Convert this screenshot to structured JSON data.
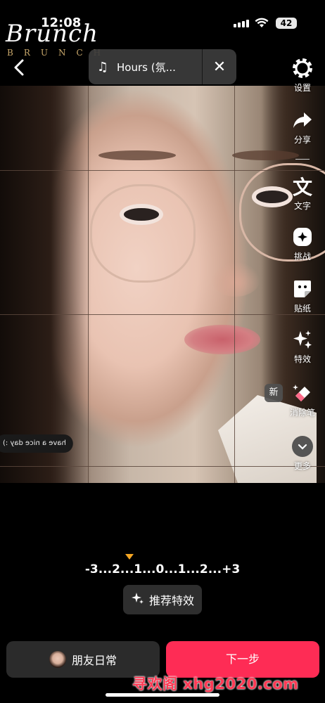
{
  "status_bar": {
    "time": "12:08",
    "battery": "42"
  },
  "brand": {
    "script": "Brunch",
    "sub": "BRUNCH"
  },
  "music": {
    "title": "Hours (氛..."
  },
  "toolbar": {
    "settings": "设置",
    "share": "分享",
    "text": "文字",
    "challenge": "挑战",
    "sticker": "贴纸",
    "effects": "特效",
    "eraser": "消除笔",
    "more": "更多",
    "new_badge": "新"
  },
  "sticker_text": "have a nice day :)",
  "exposure_scale": "-3...2...1...0...1...2...+3",
  "recommend_effects": "推荐特效",
  "friends_button": "朋友日常",
  "next_button": "下一步",
  "watermark": "寻欢阁 xhg2020.com",
  "colors": {
    "accent": "#fe2c55",
    "marker": "#f5a623"
  }
}
